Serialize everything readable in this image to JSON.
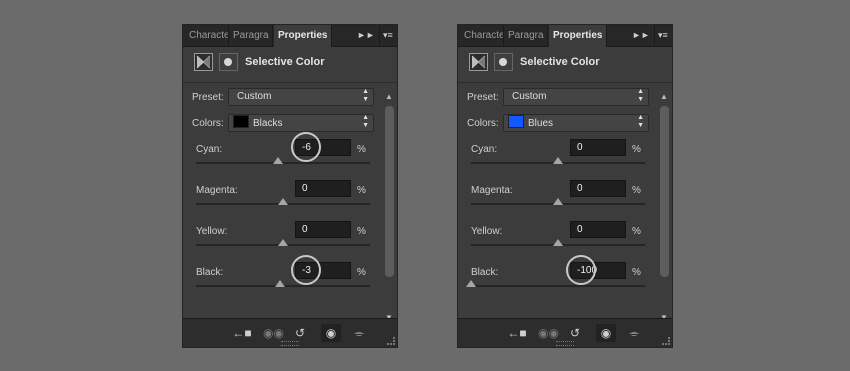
{
  "panels": [
    {
      "tabs": [
        "Characte",
        "Paragra",
        "Properties"
      ],
      "collapse_icon": "collapse-arrows-icon",
      "menu_icon": "panel-menu-icon",
      "title": "Selective Color",
      "preset_label": "Preset:",
      "preset_value": "Custom",
      "colors_label": "Colors:",
      "colors_value": "Blacks",
      "swatch_color": "#000000",
      "sliders": [
        {
          "label": "Cyan:",
          "value": "-6",
          "pct": "%",
          "level": -6
        },
        {
          "label": "Magenta:",
          "value": "0",
          "pct": "%",
          "level": 0
        },
        {
          "label": "Yellow:",
          "value": "0",
          "pct": "%",
          "level": 0
        },
        {
          "label": "Black:",
          "value": "-3",
          "pct": "%",
          "level": -3
        }
      ],
      "highlighted": [
        "Cyan:",
        "Black:"
      ]
    },
    {
      "tabs": [
        "Characte",
        "Paragra",
        "Properties"
      ],
      "collapse_icon": "collapse-arrows-icon",
      "menu_icon": "panel-menu-icon",
      "title": "Selective Color",
      "preset_label": "Preset:",
      "preset_value": "Custom",
      "colors_label": "Colors:",
      "colors_value": "Blues",
      "swatch_color": "#1158ff",
      "sliders": [
        {
          "label": "Cyan:",
          "value": "0",
          "pct": "%",
          "level": 0
        },
        {
          "label": "Magenta:",
          "value": "0",
          "pct": "%",
          "level": 0
        },
        {
          "label": "Yellow:",
          "value": "0",
          "pct": "%",
          "level": 0
        },
        {
          "label": "Black:",
          "value": "-100",
          "pct": "%",
          "level": -100
        }
      ],
      "highlighted": [
        "Black:"
      ]
    }
  ],
  "bottom_icons": [
    "clip-to-layer-icon",
    "view-previous-icon",
    "reset-icon",
    "visibility-eye-icon",
    "trash-icon"
  ],
  "colors": {
    "background": "#6b6b6b",
    "panel": "#3c3c3c",
    "highlight_ring": "#c8c8c8"
  }
}
